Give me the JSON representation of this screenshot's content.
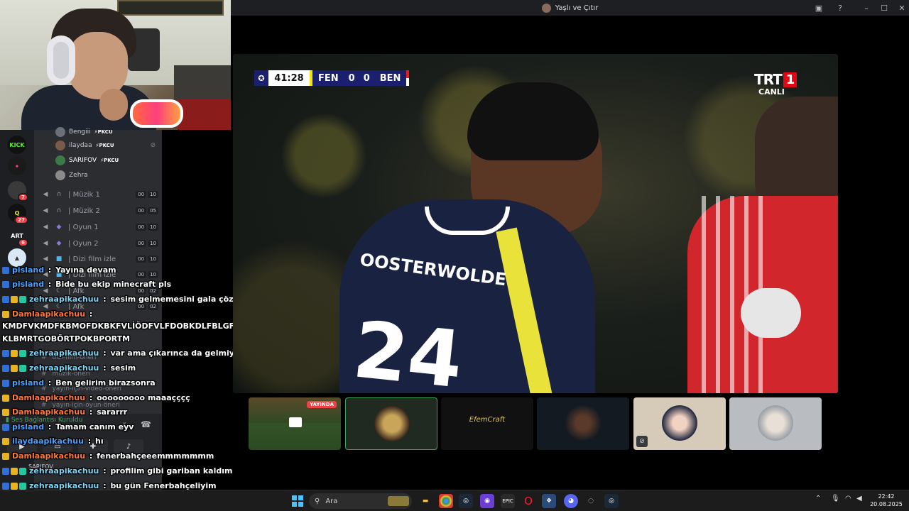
{
  "window": {
    "title": "Yaşlı ve Çıtır",
    "controls": [
      "monitor-icon",
      "help-icon",
      "minimize-icon",
      "maximize-icon",
      "close-icon"
    ]
  },
  "servers": [
    {
      "label": "KICK",
      "badge": ""
    },
    {
      "label": "",
      "badge": ""
    },
    {
      "label": "",
      "badge": "7"
    },
    {
      "label": "",
      "badge": "27"
    },
    {
      "label": "ART",
      "badge": "6"
    },
    {
      "label": "",
      "badge": ""
    }
  ],
  "voice_members": [
    {
      "name": "Bengiii",
      "tag": "PKCU"
    },
    {
      "name": "ilaydaa",
      "tag": "PKCU"
    },
    {
      "name": "SARIFOV",
      "tag": "PKCU"
    },
    {
      "name": "Zehra",
      "tag": ""
    }
  ],
  "voice_channels": [
    {
      "name": "Müzik 1",
      "count_a": "00",
      "count_b": "10"
    },
    {
      "name": "Müzik 2",
      "count_a": "00",
      "count_b": "05"
    },
    {
      "name": "Oyun 1",
      "count_a": "00",
      "count_b": "10"
    },
    {
      "name": "Oyun 2",
      "count_a": "00",
      "count_b": "10"
    },
    {
      "name": "Dizi film izle",
      "count_a": "00",
      "count_b": "10"
    },
    {
      "name": "Dizi film izle",
      "count_a": "00",
      "count_b": "10"
    },
    {
      "name": "Afk",
      "count_a": "00",
      "count_b": "02"
    },
    {
      "name": "Afk",
      "count_a": "00",
      "count_b": "02"
    }
  ],
  "text_channels": [
    "dizi-film-öneri",
    "müzik-öneri",
    "yayın-için-video-öneri",
    "yayın-için-oyun-öneri"
  ],
  "connection": {
    "status": "Ses Bağlantısı Kuruldu",
    "user": "SARIFOV"
  },
  "chat": [
    {
      "user": "pisland",
      "msg": "Yayına devam",
      "color": "#4aa3ff",
      "badges": [
        "#2f6fd6"
      ]
    },
    {
      "user": "pisland",
      "msg": "Bide bu ekip minecraft pls",
      "color": "#4aa3ff",
      "badges": [
        "#2f6fd6"
      ]
    },
    {
      "user": "zehraapikachuu",
      "msg": "sesim gelmemesini gala çözemiyom",
      "color": "#7dd7f7",
      "badges": [
        "#2f6fd6",
        "#e6b422",
        "#25c6a0"
      ]
    },
    {
      "user": "Damlaapikachuu",
      "msg": "",
      "color": "#ff7a3d",
      "badges": [
        "#e6b422"
      ]
    },
    {
      "user": "",
      "msg": "KMDFVKMDFKBMOFDKBKFVLİÖDFVLFDOBKDLFBLGFMBKFGMBLSFÖVPOKFD",
      "color": "#fff",
      "badges": []
    },
    {
      "user": "",
      "msg": "KLBMRTGOBÖRTPOKBPORTM",
      "color": "#fff",
      "badges": []
    },
    {
      "user": "zehraapikachuu",
      "msg": "var ama çıkarınca da gelmiyo",
      "color": "#7dd7f7",
      "badges": [
        "#2f6fd6",
        "#e6b422",
        "#25c6a0"
      ]
    },
    {
      "user": "zehraapikachuu",
      "msg": "sesim",
      "color": "#7dd7f7",
      "badges": [
        "#2f6fd6",
        "#e6b422",
        "#25c6a0"
      ]
    },
    {
      "user": "pisland",
      "msg": "Ben gelirim birazsonra",
      "color": "#4aa3ff",
      "badges": [
        "#2f6fd6"
      ]
    },
    {
      "user": "Damlaapikachuu",
      "msg": "ooooooooo maaaçççç",
      "color": "#ff7a3d",
      "badges": [
        "#e6b422"
      ]
    },
    {
      "user": "Damlaapikachuu",
      "msg": "sararrr",
      "color": "#ff7a3d",
      "badges": [
        "#e6b422"
      ]
    },
    {
      "user": "pisland",
      "msg": "Tamam canım eyv",
      "color": "#4aa3ff",
      "badges": [
        "#2f6fd6"
      ]
    },
    {
      "user": "ilaydaapikachuu",
      "msg": "hı",
      "color": "#4aa3ff",
      "badges": [
        "#e6b422"
      ]
    },
    {
      "user": "Damlaapikachuu",
      "msg": "fenerbahçeeemmmmmmm",
      "color": "#ff7a3d",
      "badges": [
        "#e6b422"
      ]
    },
    {
      "user": "zehraapikachuu",
      "msg": "profilim gibi gariban kaldım",
      "color": "#7dd7f7",
      "badges": [
        "#2f6fd6",
        "#e6b422",
        "#25c6a0"
      ]
    },
    {
      "user": "zehraapikachuu",
      "msg": "bu gün Fenerbahçeliyim",
      "color": "#7dd7f7",
      "badges": [
        "#2f6fd6",
        "#e6b422",
        "#25c6a0"
      ]
    }
  ],
  "broadcast": {
    "time": "41:28",
    "home": "FEN",
    "home_score": "0",
    "away_score": "0",
    "away": "BEN",
    "channel": "TRT",
    "channel_num": "1",
    "live_label": "CANLI",
    "jersey_name": "OOSTERWOLDE",
    "jersey_number": "24"
  },
  "tiles": [
    {
      "kind": "stream",
      "badge": "YAYINDA"
    },
    {
      "kind": "avatar",
      "active": true
    },
    {
      "kind": "text",
      "label": "EfemCraft"
    },
    {
      "kind": "avatar"
    },
    {
      "kind": "avatar",
      "muted": true
    },
    {
      "kind": "avatar"
    }
  ],
  "taskbar": {
    "search_placeholder": "Ara",
    "time": "22:42",
    "date": "20.08.2025",
    "apps": [
      "file-explorer-icon",
      "chrome-icon",
      "steam-icon",
      "app-icon",
      "epic-games-icon",
      "opera-icon",
      "app-icon",
      "discord-icon",
      "app-icon",
      "steam-icon"
    ]
  }
}
